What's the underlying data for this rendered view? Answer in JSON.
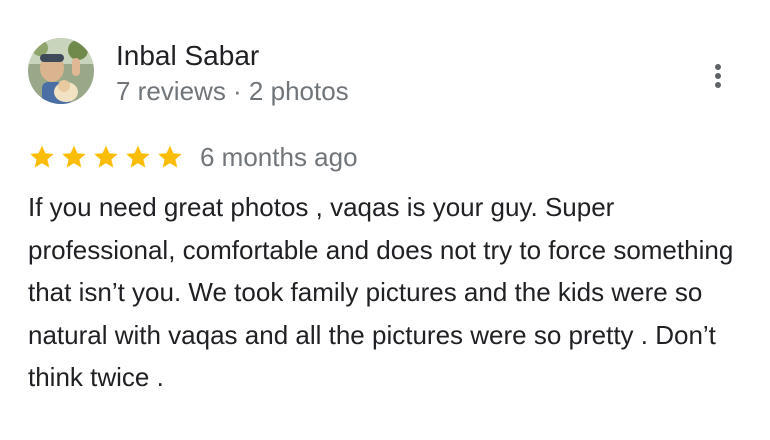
{
  "review": {
    "reviewer": {
      "name": "Inbal Sabar",
      "meta": "7 reviews · 2 photos",
      "avatar_icon": "profile-photo"
    },
    "rating": {
      "stars": 5,
      "max_stars": 5,
      "star_color": "#fbbc04"
    },
    "date": "6 months ago",
    "text": "If you need great photos , vaqas is your guy. Super professional, comfortable and does not try to force something that isn’t you. We took family pictures and the kids were so natural with vaqas and all the pictures were so pretty . Don’t think twice .",
    "more_icon": "more-vert-icon"
  },
  "colors": {
    "primary_text": "#202124",
    "secondary_text": "#70757a",
    "icon_gray": "#5f6368"
  }
}
